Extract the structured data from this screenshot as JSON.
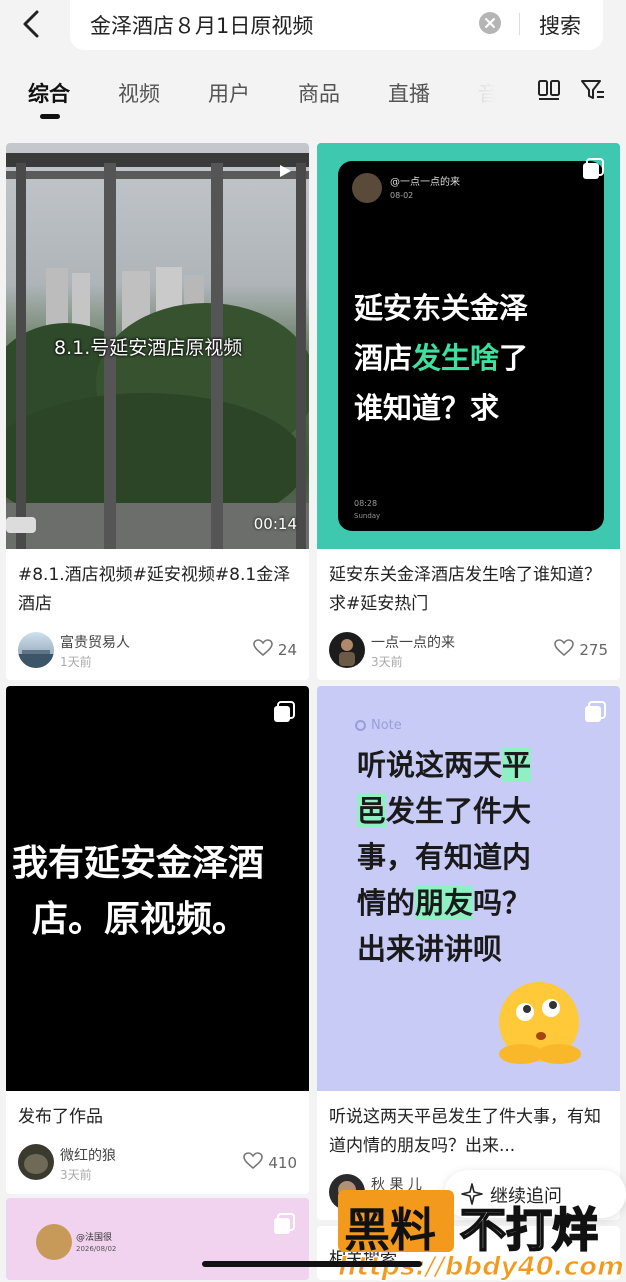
{
  "search": {
    "query": "金泽酒店８月1日原视频",
    "button": "搜索"
  },
  "tabs": [
    "综合",
    "视频",
    "用户",
    "商品",
    "直播",
    "音乐"
  ],
  "cards": [
    {
      "overlay_text": "8.1.号延安酒店原视频",
      "duration": "00:14",
      "title": "#8.1.酒店视频#延安视频#8.1金泽酒店",
      "user": "富贵贸易人",
      "time": "1天前",
      "likes": "24"
    },
    {
      "note_handle": "@一点一点的来",
      "note_date": "08-02",
      "note_lines": [
        "延安东关金泽",
        "酒店",
        "发生啥",
        "了",
        "谁知道？求"
      ],
      "note_footer_time": "08:28",
      "note_footer_day": "Sunday",
      "title": "延安东关金泽酒店发生啥了谁知道？求#延安热门",
      "user": "一点一点的来",
      "time": "3天前",
      "likes": "275"
    },
    {
      "big_text_1": "我有延安金泽酒",
      "big_text_2": "店。原视频。",
      "title": "发布了作品",
      "user": "微红的狼",
      "time": "3天前",
      "likes": "410"
    },
    {
      "note_label": "Note",
      "note_l1a": "听说这两天",
      "note_l1b": "平",
      "note_l2a": "邑",
      "note_l2b": "发生了件大",
      "note_l3": "事，有知道内",
      "note_l4a": "情的",
      "note_l4b": "朋友",
      "note_l4c": "吗？",
      "note_l5": "出来讲讲呗",
      "title": "听说这两天平邑发生了件大事，有知道内情的朋友吗？出来...",
      "user": "秋 果 儿"
    },
    {
      "note_handle": "@法国很",
      "note_date": "2026/08/02"
    }
  ],
  "related_search": "相关搜索",
  "continue_label": "继续追问",
  "watermark": {
    "text_left": "黑料",
    "text_right": "不打烊",
    "url": "https://bbdy40.com"
  },
  "colors": {
    "accent_green": "#3ee0a0",
    "teal": "#3ec8b0",
    "note_purple": "#c7cbf5"
  }
}
